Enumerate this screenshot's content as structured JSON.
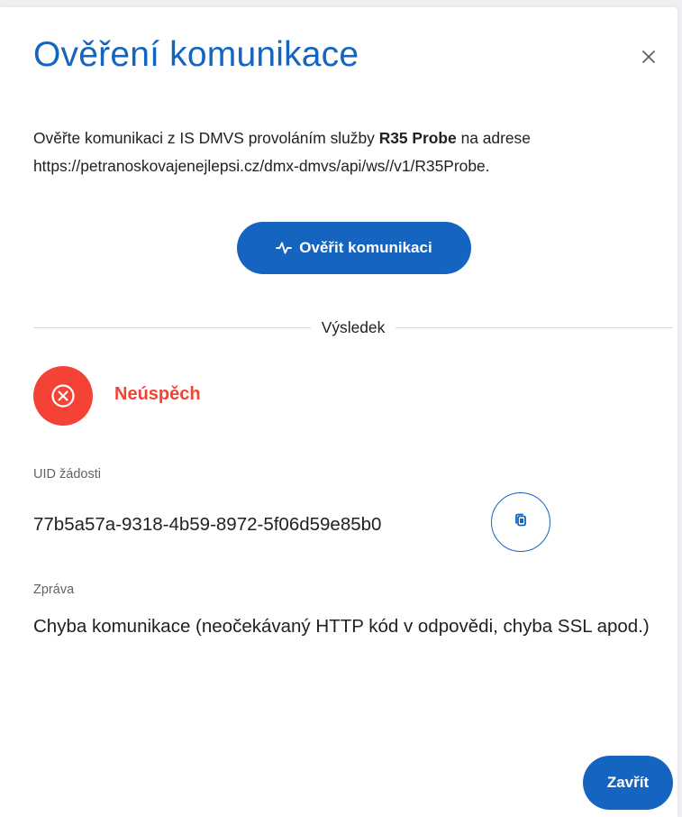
{
  "dialog": {
    "title": "Ověření komunikace",
    "close_icon": "close-icon",
    "description": {
      "before": "Ověřte komunikaci z IS DMVS provoláním služby ",
      "service": "R35 Probe",
      "after": " na adrese https://petranoskovajenejlepsi.cz/dmx-dmvs/api/ws//v1/R35Probe."
    },
    "verify_button": {
      "icon": "activity-icon",
      "label": "Ověřit komunikaci"
    },
    "divider_label": "Výsledek",
    "result": {
      "status": "error",
      "icon": "error-circle-icon",
      "label": "Neúspěch",
      "color": "#f44336"
    },
    "uid": {
      "label": "UID žádosti",
      "value": "77b5a57a-9318-4b59-8972-5f06d59e85b0",
      "copy_icon": "copy-icon"
    },
    "message": {
      "label": "Zpráva",
      "value": "Chyba komunikace (neočekávaný HTTP kód v odpovědi, chyba SSL apod.)"
    },
    "close_button_label": "Zavřít"
  },
  "colors": {
    "primary": "#1565c0",
    "error": "#f44336",
    "text": "#202124",
    "muted": "#5f6368"
  }
}
